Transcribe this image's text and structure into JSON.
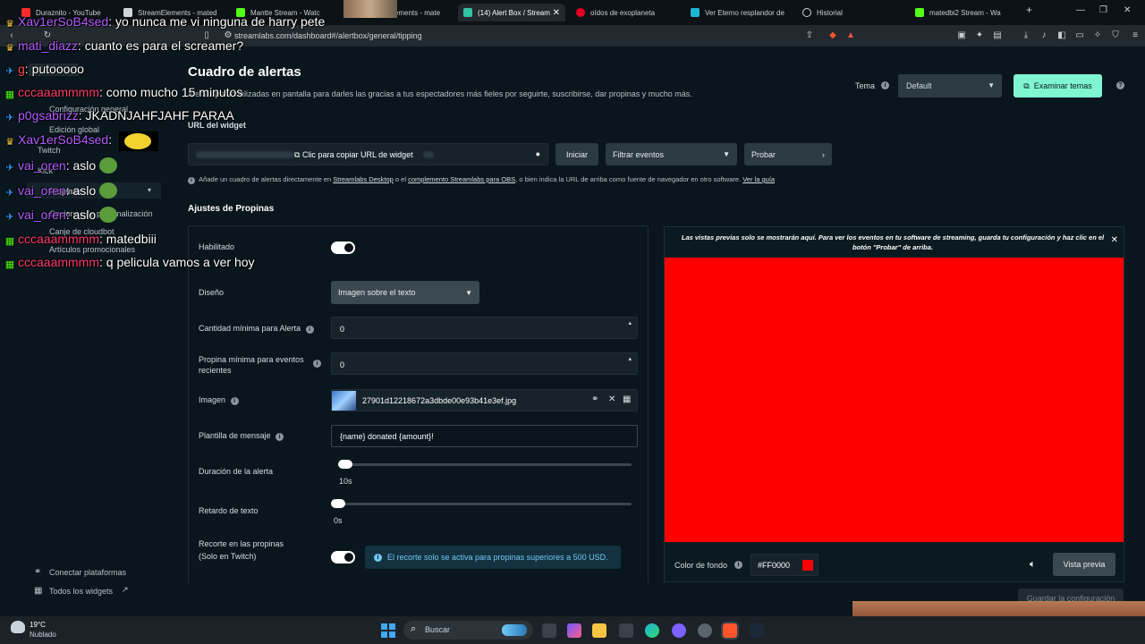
{
  "browser": {
    "tabs": [
      {
        "label": "Duraznito - YouTube",
        "color": "#ff2b2b"
      },
      {
        "label": "StreamElements - mated",
        "color": "#cfd6db"
      },
      {
        "label": "Mantte Stream - Watc",
        "color": "#53fc18"
      },
      {
        "label": "StreamElements - mate",
        "color": "#cfd6db"
      },
      {
        "label": "(14) Alert Box / Stream",
        "color": "#31c3a2"
      },
      {
        "label": "oídos de exoplaneta",
        "color": "#e60023"
      },
      {
        "label": "Ver Eterno resplandor de",
        "color": "#1fb6d6"
      },
      {
        "label": "Historial",
        "color": "#cfd6db"
      },
      {
        "label": "matedbi2 Stream - Wa",
        "color": "#53fc18"
      }
    ],
    "url": "streamlabs.com/dashboard#/alertbox/general/tipping"
  },
  "sidebar": {
    "items": [
      {
        "label": "Configuración general"
      },
      {
        "label": "Edición global"
      },
      {
        "label": "Twitch"
      },
      {
        "label": "Kick"
      },
      {
        "label": "Propinas"
      },
      {
        "label": "Opciones de personalización"
      },
      {
        "label": "Canje de cloudbot"
      },
      {
        "label": "Artículos promocionales"
      }
    ],
    "connect_label": "Conectar plataformas",
    "widgets_label": "Todos los widgets"
  },
  "header": {
    "title": "Cuadro de alertas",
    "subtitle": "Alertas personalizadas en pantalla para darles las gracias a tus espectadores más fieles por seguirte, suscribirse, dar propinas y mucho más.",
    "theme_label": "Tema",
    "theme_value": "Default",
    "explore_label": "Examinar temas"
  },
  "widget": {
    "url_label": "URL del widget",
    "copy_label": "Clic para copiar URL de widget",
    "start_label": "Iniciar",
    "filter_label": "Filtrar eventos",
    "test_label": "Probar",
    "hint_prefix": "Añade un cuadro de alertas directamente en",
    "hint_link1": "Streamlabs Desktop",
    "hint_mid": "o el",
    "hint_link2": "complemento Streamlabs para OBS",
    "hint_suffix": ", o bien indica la URL de arriba como fuente de navegador en otro software.",
    "hint_link3": "Ver la guía"
  },
  "settings": {
    "section_title": "Ajustes de Propinas",
    "enabled_label": "Habilitado",
    "design_label": "Diseño",
    "design_value": "Imagen sobre el texto",
    "min_amount_label": "Cantidad mínima para Alerta",
    "min_amount_value": "0",
    "min_recent_label": "Propina mínima para eventos recientes",
    "min_recent_value": "0",
    "image_label": "Imagen",
    "image_file": "27901d12218672a3dbde00e93b41e3ef.jpg",
    "template_label": "Plantilla de mensaje",
    "template_value": "{name} donated {amount}!",
    "duration_label": "Duración de la alerta",
    "duration_value": "10s",
    "delay_label": "Retardo de texto",
    "delay_value": "0s",
    "cut_label": "Recorte en las propinas",
    "cut_sublabel": "(Solo en Twitch)",
    "cut_info": "El recorte solo se activa para propinas superiores a 500 USD."
  },
  "preview": {
    "notice": "Las vistas previas solo se mostrarán aquí. Para ver los eventos en tu software de streaming, guarda tu configuración y haz clic en el botón \"Probar\" de arriba.",
    "bg_color": "#FF0000",
    "bg_label": "Color de fondo",
    "bg_value": "#FF0000",
    "preview_btn": "Vista previa",
    "save_btn": "Guardar la configuración"
  },
  "chat": [
    {
      "user": "Xav1erSoB4sed",
      "color": "#b55cff",
      "text": "yo nunca me vi ninguna de harry pete",
      "badge": "crown"
    },
    {
      "user": "mati_diazz",
      "color": "#b55cff",
      "text": "cuanto es para el screamer?",
      "badge": "crown"
    },
    {
      "user": "g",
      "color": "#ff4d4d",
      "text": "putooooo",
      "badge": "sword"
    },
    {
      "user": "cccaaammmm",
      "color": "#ff3b6b",
      "text": "como mucho 15 minutos",
      "badge": "grid"
    },
    {
      "user": "p0gsabrizz",
      "color": "#b55cff",
      "text": "JKADNJAHFJAHF PARAA",
      "badge": "sword"
    },
    {
      "user": "Xav1erSoB4sed",
      "color": "#b55cff",
      "text": "",
      "badge": "crown"
    },
    {
      "user": "vai_oren",
      "color": "#b55cff",
      "text": "aslo",
      "badge": "sword"
    },
    {
      "user": "vai_oren",
      "color": "#b55cff",
      "text": "aslo",
      "badge": "sword"
    },
    {
      "user": "vai_oren",
      "color": "#b55cff",
      "text": "aslo",
      "badge": "sword"
    },
    {
      "user": "cccaaammmm",
      "color": "#ff3b6b",
      "text": "matedbiii",
      "badge": "grid"
    },
    {
      "user": "cccaaammmm",
      "color": "#ff3b6b",
      "text": "q pelicula vamos a ver hoy",
      "badge": "grid"
    }
  ],
  "taskbar": {
    "weather_temp": "19°C",
    "weather_desc": "Nublado",
    "search_placeholder": "Buscar"
  }
}
